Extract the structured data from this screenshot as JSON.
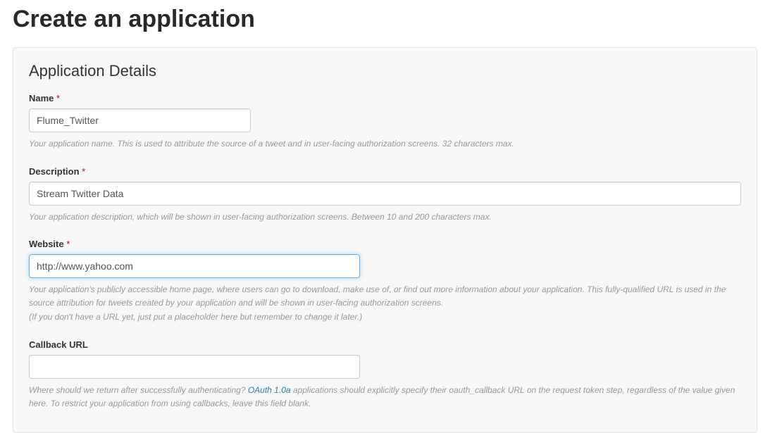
{
  "page_title": "Create an application",
  "panel": {
    "heading": "Application Details",
    "required_mark": "*",
    "fields": {
      "name": {
        "label": "Name",
        "value": "Flume_Twitter",
        "help": "Your application name. This is used to attribute the source of a tweet and in user-facing authorization screens. 32 characters max."
      },
      "description": {
        "label": "Description",
        "value": "Stream Twitter Data",
        "help": "Your application description, which will be shown in user-facing authorization screens. Between 10 and 200 characters max."
      },
      "website": {
        "label": "Website",
        "value": "http://www.yahoo.com",
        "help_line1": "Your application's publicly accessible home page, where users can go to download, make use of, or find out more information about your application. This fully-qualified URL is used in the source attribution for tweets created by your application and will be shown in user-facing authorization screens.",
        "help_line2": "(If you don't have a URL yet, just put a placeholder here but remember to change it later.)"
      },
      "callback": {
        "label": "Callback URL",
        "value": "",
        "help_pre": "Where should we return after successfully authenticating? ",
        "help_link": "OAuth 1.0a",
        "help_post": " applications should explicitly specify their oauth_callback URL on the request token step, regardless of the value given here. To restrict your application from using callbacks, leave this field blank."
      }
    }
  }
}
